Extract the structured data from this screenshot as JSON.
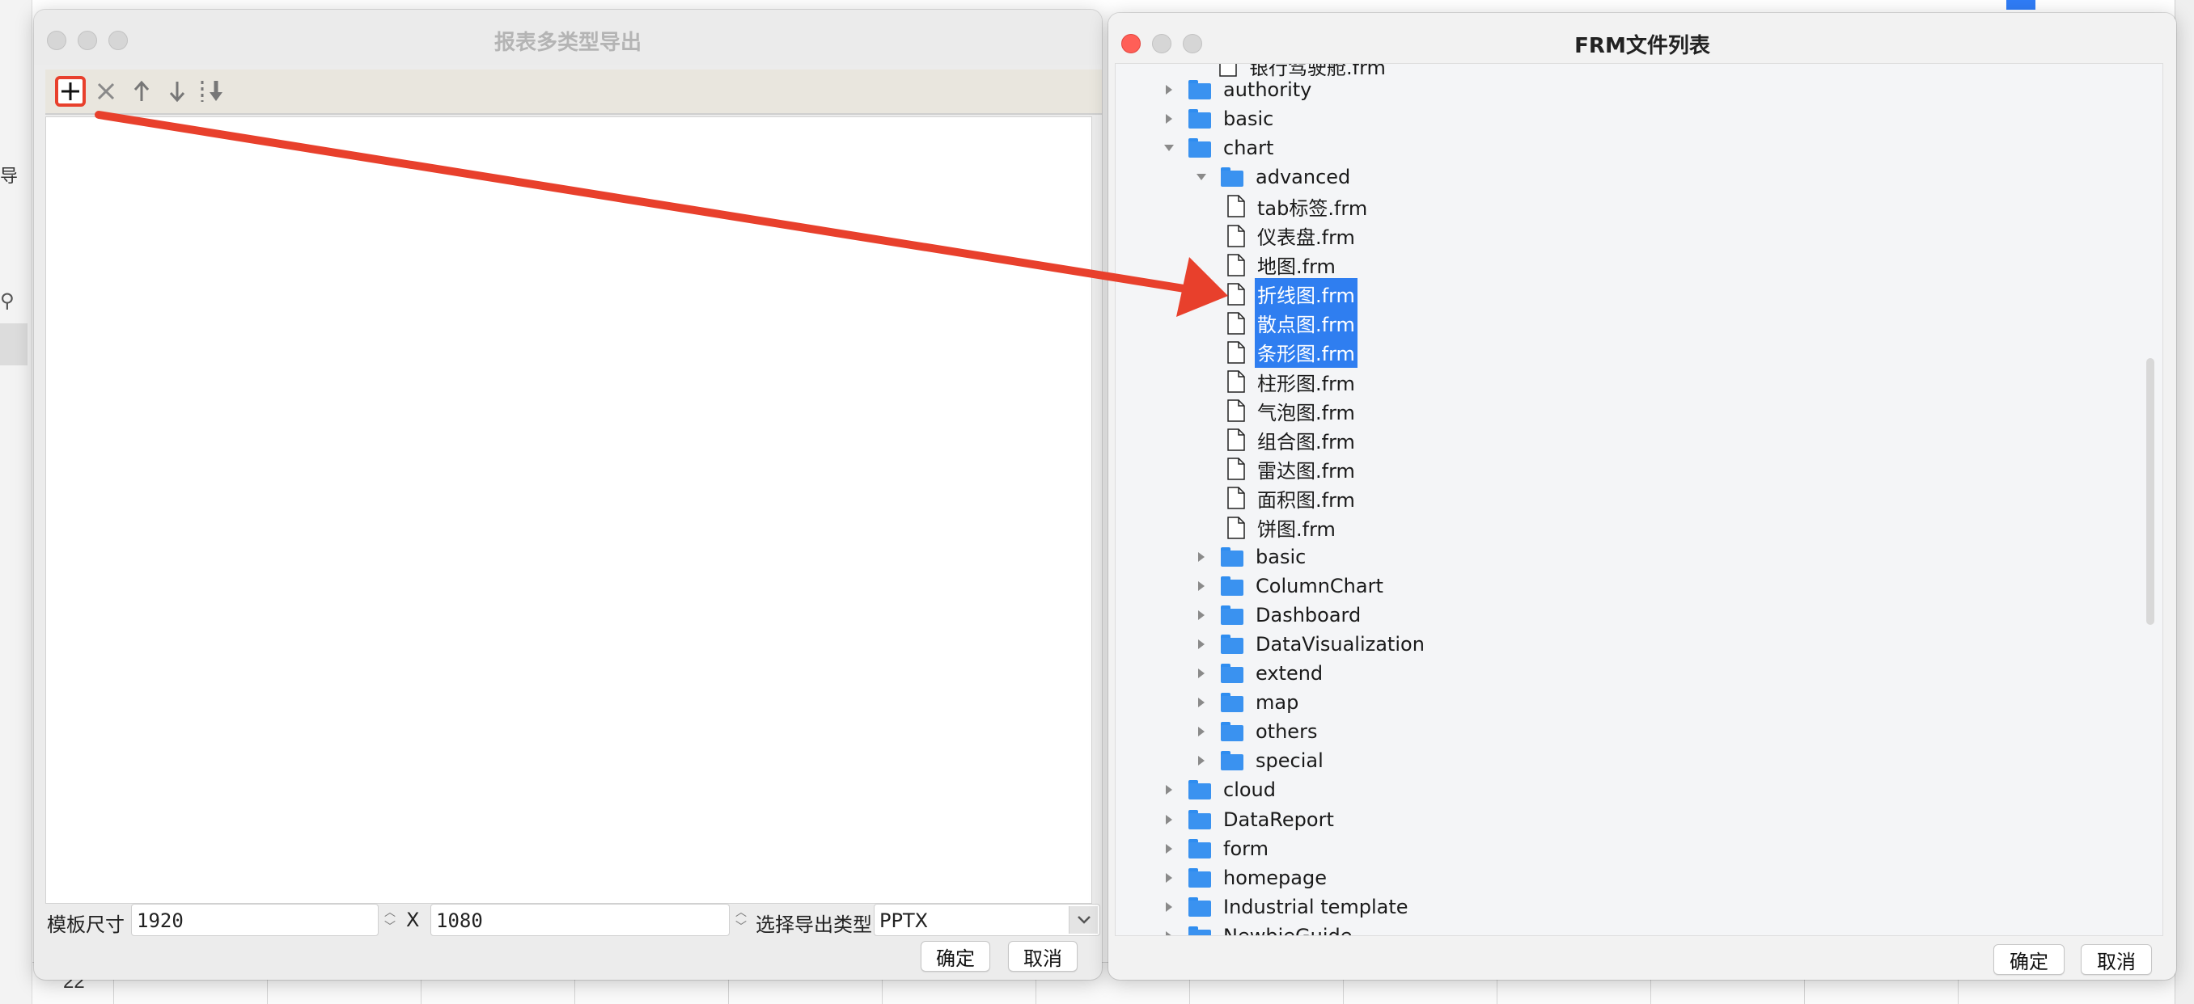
{
  "background": {
    "left_fragment": "导",
    "row_number": "22"
  },
  "export_window": {
    "title": "报表多类型导出",
    "toolbar": {
      "add_icon": "plus-icon",
      "delete_icon": "x-icon",
      "up_icon": "arrow-up-icon",
      "down_icon": "arrow-down-icon",
      "bottom_icon": "move-to-bottom-icon"
    },
    "size_label": "模板尺寸",
    "width_value": "1920",
    "x_separator": "X",
    "height_value": "1080",
    "type_label": "选择导出类型",
    "type_value": "PPTX",
    "ok_label": "确定",
    "cancel_label": "取消"
  },
  "frm_window": {
    "title": "FRM文件列表",
    "top_cutoff": "银行驾驶舱.frm",
    "tree": [
      {
        "label": "authority",
        "kind": "folder",
        "depth": 0,
        "state": "collapsed",
        "selected": false
      },
      {
        "label": "basic",
        "kind": "folder",
        "depth": 0,
        "state": "collapsed",
        "selected": false
      },
      {
        "label": "chart",
        "kind": "folder",
        "depth": 0,
        "state": "expanded",
        "selected": false
      },
      {
        "label": "advanced",
        "kind": "folder",
        "depth": 1,
        "state": "expanded",
        "selected": false
      },
      {
        "label": "tab标签.frm",
        "kind": "file",
        "depth": 2,
        "state": "",
        "selected": false
      },
      {
        "label": "仪表盘.frm",
        "kind": "file",
        "depth": 2,
        "state": "",
        "selected": false
      },
      {
        "label": "地图.frm",
        "kind": "file",
        "depth": 2,
        "state": "",
        "selected": false
      },
      {
        "label": "折线图.frm",
        "kind": "file",
        "depth": 2,
        "state": "",
        "selected": true
      },
      {
        "label": "散点图.frm",
        "kind": "file",
        "depth": 2,
        "state": "",
        "selected": true
      },
      {
        "label": "条形图.frm",
        "kind": "file",
        "depth": 2,
        "state": "",
        "selected": true
      },
      {
        "label": "柱形图.frm",
        "kind": "file",
        "depth": 2,
        "state": "",
        "selected": false
      },
      {
        "label": "气泡图.frm",
        "kind": "file",
        "depth": 2,
        "state": "",
        "selected": false
      },
      {
        "label": "组合图.frm",
        "kind": "file",
        "depth": 2,
        "state": "",
        "selected": false
      },
      {
        "label": "雷达图.frm",
        "kind": "file",
        "depth": 2,
        "state": "",
        "selected": false
      },
      {
        "label": "面积图.frm",
        "kind": "file",
        "depth": 2,
        "state": "",
        "selected": false
      },
      {
        "label": "饼图.frm",
        "kind": "file",
        "depth": 2,
        "state": "",
        "selected": false
      },
      {
        "label": "basic",
        "kind": "folder",
        "depth": 1,
        "state": "collapsed",
        "selected": false
      },
      {
        "label": "ColumnChart",
        "kind": "folder",
        "depth": 1,
        "state": "collapsed",
        "selected": false
      },
      {
        "label": "Dashboard",
        "kind": "folder",
        "depth": 1,
        "state": "collapsed",
        "selected": false
      },
      {
        "label": "DataVisualization",
        "kind": "folder",
        "depth": 1,
        "state": "collapsed",
        "selected": false
      },
      {
        "label": "extend",
        "kind": "folder",
        "depth": 1,
        "state": "collapsed",
        "selected": false
      },
      {
        "label": "map",
        "kind": "folder",
        "depth": 1,
        "state": "collapsed",
        "selected": false
      },
      {
        "label": "others",
        "kind": "folder",
        "depth": 1,
        "state": "collapsed",
        "selected": false
      },
      {
        "label": "special",
        "kind": "folder",
        "depth": 1,
        "state": "collapsed",
        "selected": false
      },
      {
        "label": "cloud",
        "kind": "folder",
        "depth": 0,
        "state": "collapsed",
        "selected": false
      },
      {
        "label": "DataReport",
        "kind": "folder",
        "depth": 0,
        "state": "collapsed",
        "selected": false
      },
      {
        "label": "form",
        "kind": "folder",
        "depth": 0,
        "state": "collapsed",
        "selected": false
      },
      {
        "label": "homepage",
        "kind": "folder",
        "depth": 0,
        "state": "collapsed",
        "selected": false
      },
      {
        "label": "Industrial template",
        "kind": "folder",
        "depth": 0,
        "state": "collapsed",
        "selected": false
      },
      {
        "label": "NewbieGuide",
        "kind": "folder",
        "depth": 0,
        "state": "collapsed",
        "selected": false
      }
    ],
    "ok_label": "确定",
    "cancel_label": "取消"
  },
  "colors": {
    "accent_selection": "#2f7ef0",
    "folder": "#3a92f0",
    "annotation": "#e8402c"
  }
}
